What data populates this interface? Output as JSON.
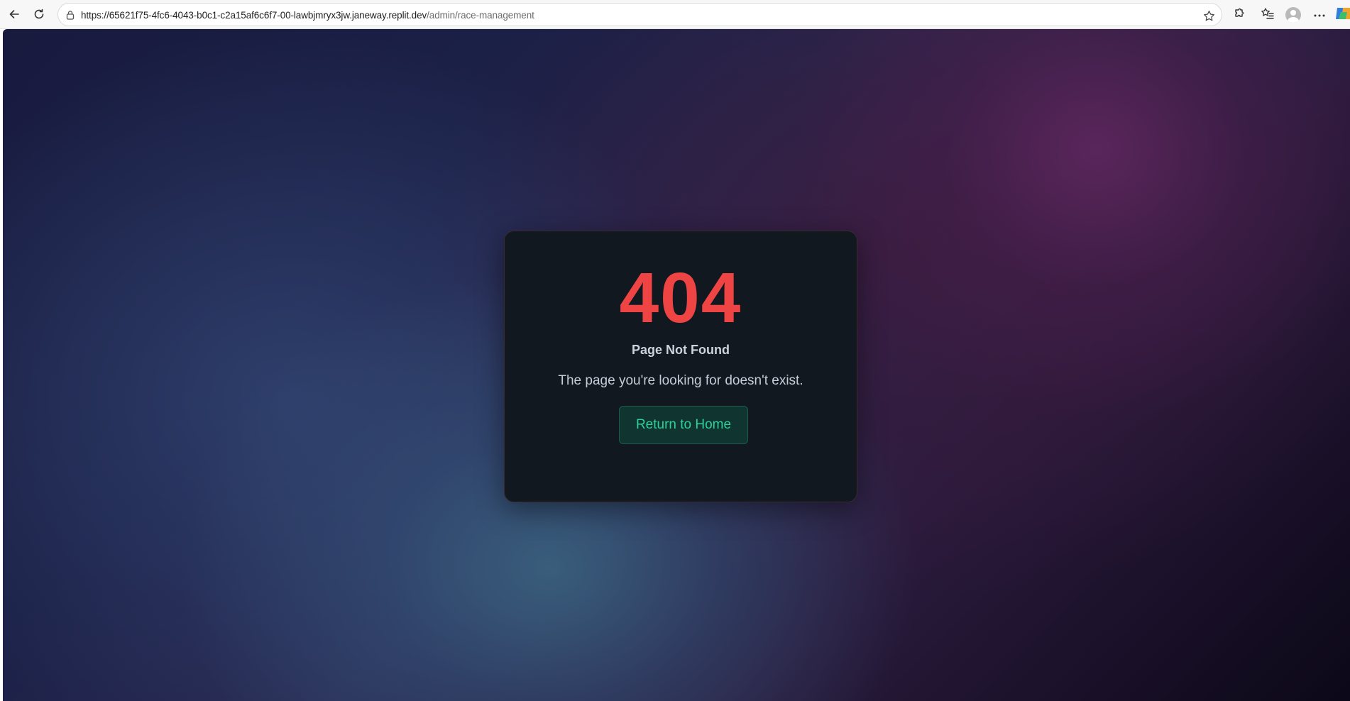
{
  "browser": {
    "url_host": "https://65621f75-4fc6-4043-b0c1-c2a15af6c6f7-00-lawbjmryx3jw.janeway.replit.dev",
    "url_path": "/admin/race-management",
    "icons": {
      "back": "arrow-left-icon",
      "reload": "reload-icon",
      "lock": "lock-icon",
      "favorite": "star-icon",
      "extensions": "puzzle-icon",
      "favorites": "favorites-list-icon",
      "profile": "profile-avatar-icon",
      "more": "ellipsis-icon",
      "copilot": "copilot-icon"
    }
  },
  "error_page": {
    "code": "404",
    "title": "Page Not Found",
    "message": "The page you're looking for doesn't exist.",
    "home_button_label": "Return to Home"
  },
  "colors": {
    "error_code": "#ef4444",
    "button_text": "#2fd09a",
    "button_background": "#10342f",
    "card_background": "#111820"
  }
}
